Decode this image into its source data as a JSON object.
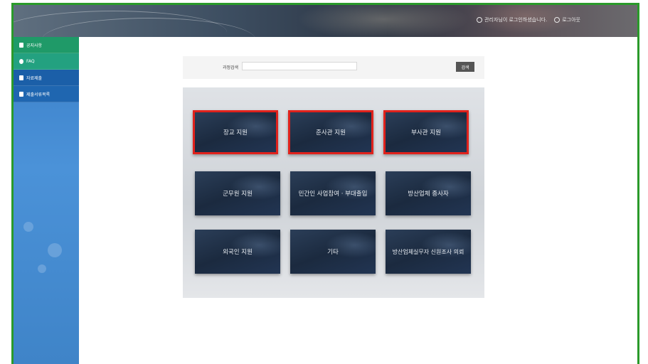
{
  "header": {
    "login_status": "관리자님이 로그인하셨습니다.",
    "logout_label": "로그아웃"
  },
  "sidebar": {
    "items": [
      {
        "label": "공지사항",
        "icon": "microphone-icon"
      },
      {
        "label": "FAQ",
        "icon": "chat-bubble-icon"
      },
      {
        "label": "자료제출",
        "icon": "lock-icon"
      },
      {
        "label": "제출서류목록",
        "icon": "document-icon"
      }
    ]
  },
  "search": {
    "label": "과정검색",
    "placeholder": "",
    "button_label": "검색"
  },
  "tiles": [
    {
      "label": "장교 지원",
      "highlighted": true
    },
    {
      "label": "준사관 지원",
      "highlighted": true
    },
    {
      "label": "부사관 지원",
      "highlighted": true
    },
    {
      "label": "군무원 지원",
      "highlighted": false
    },
    {
      "label": "민간인 사업참여 · 부대출입",
      "highlighted": false
    },
    {
      "label": "방산업체 종사자",
      "highlighted": false
    },
    {
      "label": "외국인 지원",
      "highlighted": false
    },
    {
      "label": "기타",
      "highlighted": false
    },
    {
      "label": "방산업체실무자 신원조사 의뢰",
      "highlighted": false
    }
  ],
  "colors": {
    "frame_border": "#2a9a2a",
    "highlight_border": "#e0221c",
    "sidebar_bg": "#4b92d8",
    "tile_bg": "#1b2a3f"
  }
}
